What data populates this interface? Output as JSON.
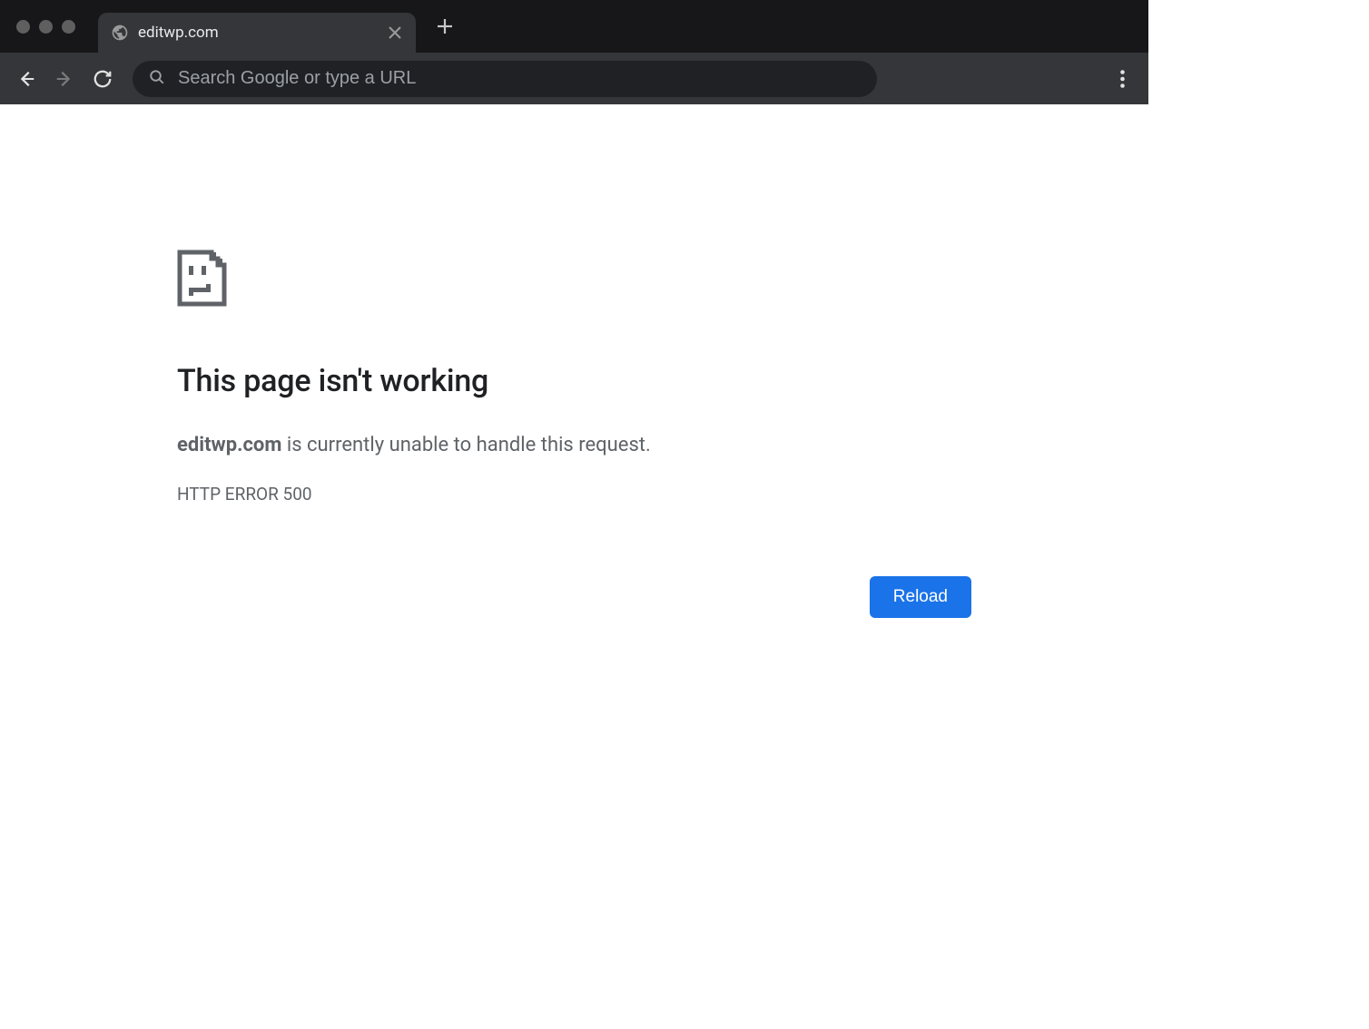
{
  "browser": {
    "tab": {
      "title": "editwp.com"
    },
    "omnibox": {
      "placeholder": "Search Google or type a URL",
      "value": ""
    }
  },
  "error": {
    "title": "This page isn't working",
    "domain": "editwp.com",
    "message_suffix": " is currently unable to handle this request.",
    "code": "HTTP ERROR 500",
    "reload_label": "Reload"
  }
}
